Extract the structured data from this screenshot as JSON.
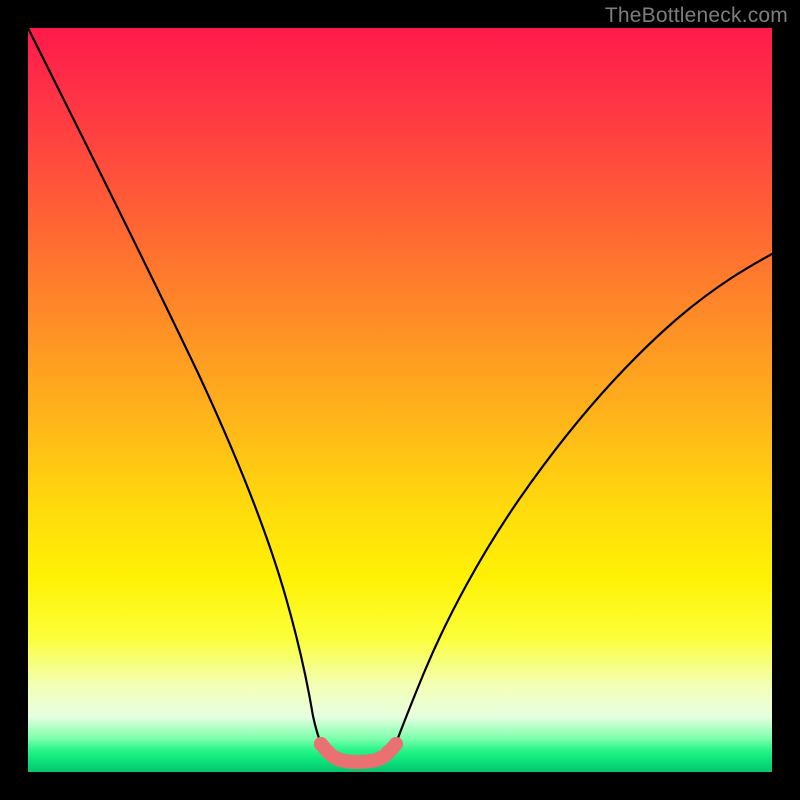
{
  "watermark": "TheBottleneck.com",
  "colors": {
    "curve_black": "#000000",
    "dip_pink": "#e97171",
    "gradient_top": "#ff1a4a",
    "gradient_bottom": "#06c46f"
  },
  "chart_data": {
    "type": "line",
    "title": "",
    "xlabel": "",
    "ylabel": "",
    "xlim": [
      0,
      100
    ],
    "ylim": [
      0,
      100
    ],
    "grid": false,
    "legend": false,
    "series": [
      {
        "name": "left-branch",
        "color": "#000000",
        "x": [
          0,
          4,
          8,
          12,
          16,
          20,
          24,
          28,
          30,
          32,
          34,
          35.5,
          37
        ],
        "y": [
          100,
          90,
          79,
          67.5,
          56,
          45,
          34,
          23.5,
          18.5,
          14,
          10,
          7.5,
          5.3
        ]
      },
      {
        "name": "right-branch",
        "color": "#000000",
        "x": [
          47,
          50,
          54,
          58,
          63,
          68,
          74,
          80,
          86,
          92,
          98,
          100
        ],
        "y": [
          5.3,
          8,
          12,
          17,
          23.5,
          30,
          37.5,
          44.5,
          51,
          57,
          62.5,
          64
        ]
      },
      {
        "name": "dip-segment",
        "color": "#e97171",
        "x": [
          37,
          38,
          39,
          40,
          41,
          42,
          43,
          44,
          45,
          46,
          47
        ],
        "y": [
          5.3,
          3.6,
          2.5,
          1.9,
          1.6,
          1.5,
          1.6,
          1.9,
          2.5,
          3.6,
          5.3
        ]
      }
    ],
    "annotations": [
      {
        "text": "TheBottleneck.com",
        "position": "top-right"
      }
    ]
  }
}
